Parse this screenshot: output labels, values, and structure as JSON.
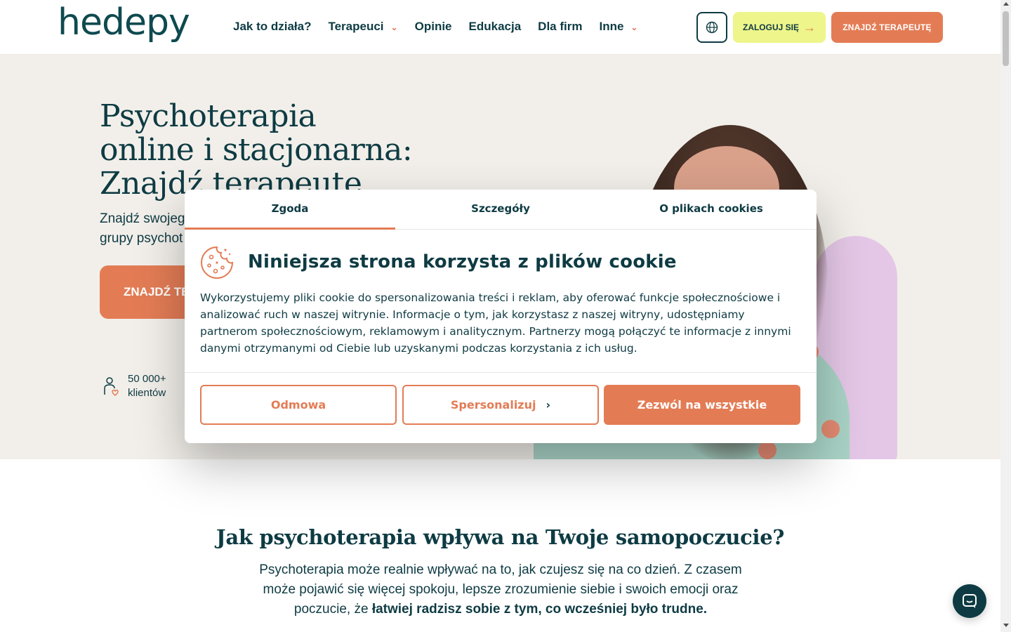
{
  "header": {
    "logo": "hedepy",
    "nav": [
      {
        "label": "Jak to działa?",
        "has_dropdown": false
      },
      {
        "label": "Terapeuci",
        "has_dropdown": true
      },
      {
        "label": "Opinie",
        "has_dropdown": false
      },
      {
        "label": "Edukacja",
        "has_dropdown": false
      },
      {
        "label": "Dla firm",
        "has_dropdown": false
      },
      {
        "label": "Inne",
        "has_dropdown": true
      }
    ],
    "login_label": "ZALOGUJ SIĘ",
    "find_label": "ZNAJDŹ TERAPEUTĘ"
  },
  "hero": {
    "title_line1": "Psychoterapia",
    "title_line2": "online i stacjonarna:",
    "title_line3": "Znajdź terapeutę",
    "subtitle_line1": "Znajdź swojego",
    "subtitle_line2": "grupy psychot",
    "cta_label": "ZNAJDŹ TE",
    "stat_value": "50 000+",
    "stat_label": "klientów"
  },
  "section": {
    "title": "Jak psychoterapia wpływa na Twoje samopoczucie?",
    "text_part1": "Psychoterapia może realnie wpływać na to, jak czujesz się na co dzień. Z czasem może pojawić się więcej spokoju, lepsze zrozumienie siebie i swoich emocji oraz poczucie, że ",
    "text_bold": "łatwiej radzisz sobie z tym, co wcześniej było trudne."
  },
  "cookie_modal": {
    "tabs": [
      "Zgoda",
      "Szczegóły",
      "O plikach cookies"
    ],
    "active_tab": "Zgoda",
    "title": "Niniejsza strona korzysta z plików cookie",
    "body": "Wykorzystujemy pliki cookie do spersonalizowania treści i reklam, aby oferować funkcje społecznościowe i analizować ruch w naszej witrynie. Informacje o tym, jak korzystasz z naszej witryny, udostępniamy partnerom społecznościowym, reklamowym i analitycznym. Partnerzy mogą połączyć te informacje z innymi danymi otrzymanymi od Ciebie lub uzyskanymi podczas korzystania z ich usług.",
    "deny_label": "Odmowa",
    "customize_label": "Spersonalizuj",
    "allow_label": "Zezwól na wszystkie"
  },
  "colors": {
    "primary": "#0e3b43",
    "accent": "#e37c55",
    "login_bg": "#eef58a",
    "hero_bg": "#f2efea"
  },
  "icons": [
    "globe-icon",
    "arrow-right-icon",
    "chevron-down-icon",
    "cookie-icon",
    "chevron-right-icon",
    "clients-icon",
    "chat-icon"
  ]
}
